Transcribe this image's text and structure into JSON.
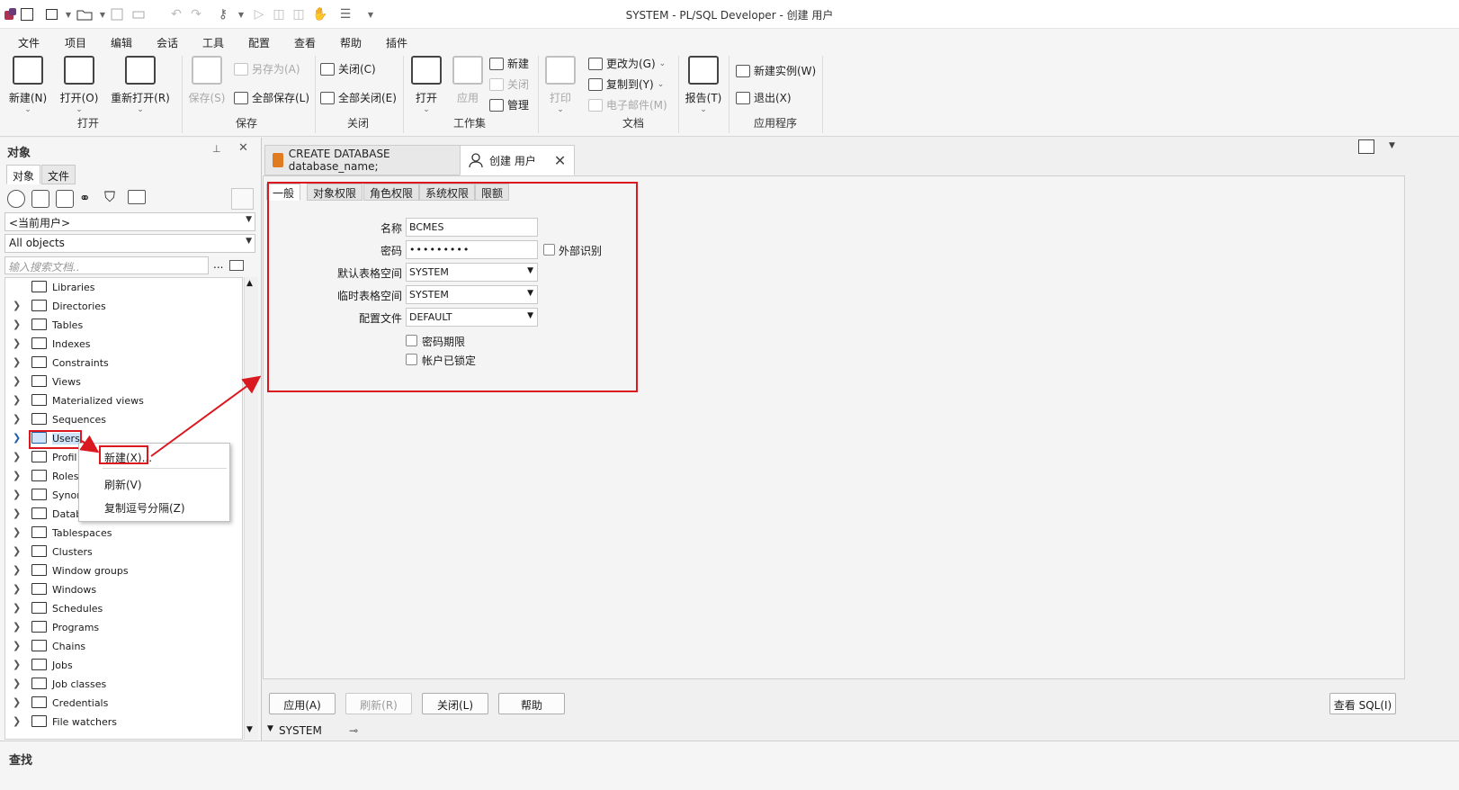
{
  "window": {
    "title": "SYSTEM - PL/SQL Developer - 创建 用户"
  },
  "menu": [
    "文件",
    "项目",
    "编辑",
    "会话",
    "工具",
    "配置",
    "查看",
    "帮助",
    "插件"
  ],
  "ribbon": {
    "new": "新建(N)",
    "open": "打开(O)",
    "reopen": "重新打开(R)",
    "save": "保存(S)",
    "save_as": "另存为(A)",
    "save_all": "全部保存(L)",
    "close": "关闭(C)",
    "close_all": "全部关闭(E)",
    "ws_open": "打开",
    "ws_apply": "应用",
    "ws_new": "新建",
    "ws_close": "关闭",
    "ws_manage": "管理",
    "print": "打印",
    "change_to": "更改为(G)",
    "copy_to": "复制到(Y)",
    "email": "电子邮件(M)",
    "report": "报告(T)",
    "new_instance": "新建实例(W)",
    "exit": "退出(X)",
    "groups": {
      "open": "打开",
      "save": "保存",
      "close": "关闭",
      "workset": "工作集",
      "document": "文档",
      "app": "应用程序"
    }
  },
  "objects_pane": {
    "title": "对象",
    "tabs": [
      "对象",
      "文件"
    ],
    "user_filter": "<当前用户>",
    "object_filter": "All objects",
    "search_placeholder": "输入搜索文档..",
    "more": "...",
    "tree": [
      "Libraries",
      "Directories",
      "Tables",
      "Indexes",
      "Constraints",
      "Views",
      "Materialized views",
      "Sequences",
      "Users",
      "Profil",
      "Roles",
      "Synor",
      "Datab",
      "Tablespaces",
      "Clusters",
      "Window groups",
      "Windows",
      "Schedules",
      "Programs",
      "Chains",
      "Jobs",
      "Job classes",
      "Credentials",
      "File watchers"
    ]
  },
  "context_menu": {
    "new": "新建(X)...",
    "refresh": "刷新(V)",
    "copy": "复制逗号分隔(Z)"
  },
  "editor": {
    "tabs": [
      "CREATE DATABASE database_name;",
      "创建 用户"
    ],
    "inner_tabs": [
      "一般",
      "对象权限",
      "角色权限",
      "系统权限",
      "限额"
    ],
    "form": {
      "name_label": "名称",
      "name_value": "BCMES",
      "pwd_label": "密码",
      "pwd_value": "•••••••••",
      "external_label": "外部识别",
      "def_ts_label": "默认表格空间",
      "def_ts_value": "SYSTEM",
      "tmp_ts_label": "临时表格空间",
      "tmp_ts_value": "SYSTEM",
      "profile_label": "配置文件",
      "profile_value": "DEFAULT",
      "pwd_expire": "密码期限",
      "locked": "帐户已锁定"
    },
    "buttons": {
      "apply": "应用(A)",
      "refresh": "刷新(R)",
      "close": "关闭(L)",
      "help": "帮助",
      "view_sql": "查看 SQL(I)"
    },
    "session": "SYSTEM"
  },
  "status": {
    "find": "查找"
  },
  "colors": {
    "annotation_red": "#d9191f",
    "selection": "#cfe4fa"
  }
}
